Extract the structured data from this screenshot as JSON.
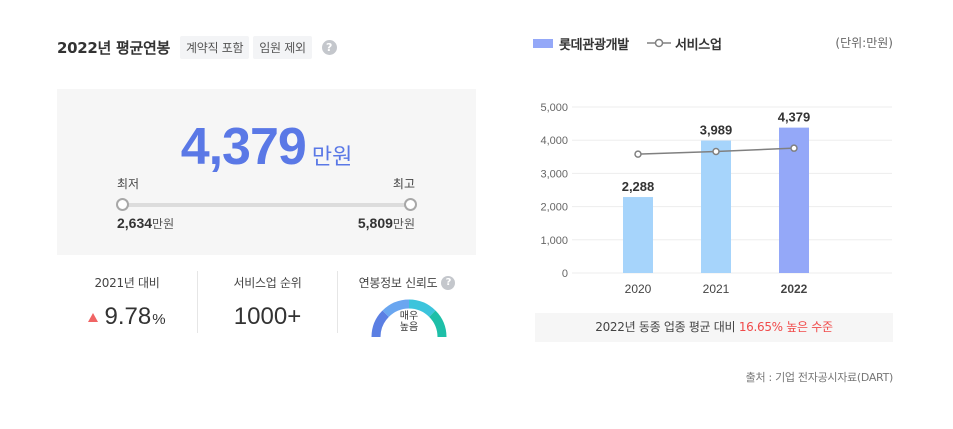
{
  "salary": {
    "title": "2022년 평균연봉",
    "tags": [
      "계약직 포함",
      "임원 제외"
    ],
    "help_glyph": "?",
    "average": "4,379",
    "average_unit": "만원",
    "min_label": "최저",
    "max_label": "최고",
    "min_value": "2,634",
    "max_value": "5,809",
    "value_unit": "만원"
  },
  "stats": {
    "growth_label": "2021년 대비",
    "growth_value": "9.78",
    "growth_unit": "%",
    "growth_direction": "up",
    "rank_label": "서비스업 순위",
    "rank_value": "1000+",
    "reliability_label": "연봉정보 신뢰도",
    "reliability_line1": "매우",
    "reliability_line2": "높음"
  },
  "legend": {
    "bar_series": "롯데관광개발",
    "line_series": "서비스업",
    "unit_note": "(단위:만원)"
  },
  "footer": {
    "prefix": "2022년 동종 업종 평균 대비",
    "highlight": "16.65% 높은 수준"
  },
  "source": "출처 : 기업 전자공시자료(DART)",
  "colors": {
    "accent": "#5a78e6",
    "bar": "#a6d4fb",
    "bar_highlight": "#94a8f8",
    "line": "#808080",
    "positive": "#f04a4a"
  },
  "chart_data": {
    "type": "bar",
    "categories": [
      "2020",
      "2021",
      "2022"
    ],
    "series": [
      {
        "name": "롯데관광개발",
        "type": "bar",
        "values": [
          2288,
          3989,
          4379
        ],
        "labels": [
          "2,288",
          "3,989",
          "4,379"
        ]
      },
      {
        "name": "서비스업",
        "type": "line",
        "values": [
          3580,
          3660,
          3760
        ]
      }
    ],
    "ylim": [
      0,
      5000
    ],
    "yticks": [
      0,
      1000,
      2000,
      3000,
      4000,
      5000
    ],
    "ytick_labels": [
      "0",
      "1,000",
      "2,000",
      "3,000",
      "4,000",
      "5,000"
    ],
    "grid": true,
    "legend_position": "top-left"
  }
}
